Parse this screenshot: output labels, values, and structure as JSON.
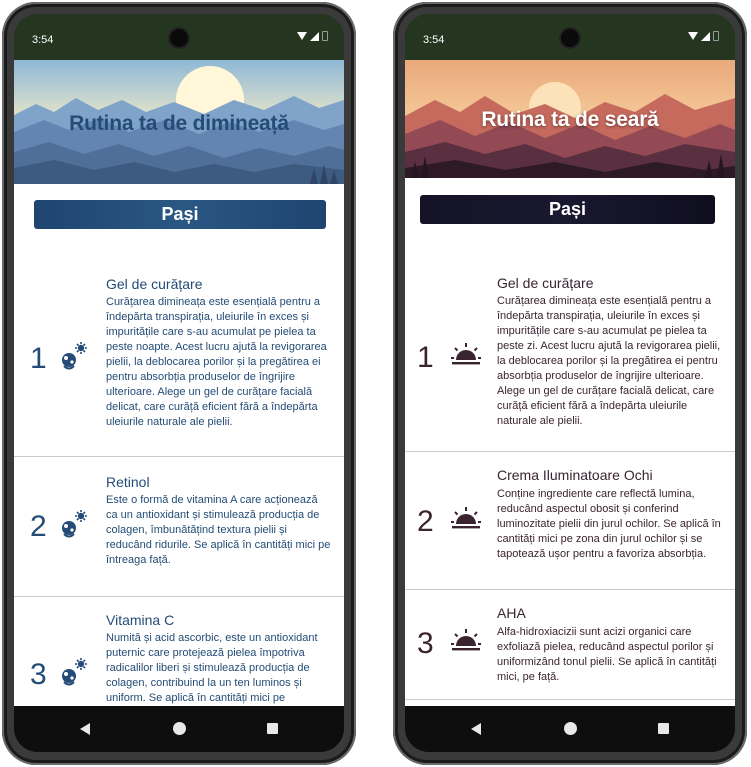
{
  "left": {
    "status_time": "3:54",
    "banner_title": "Rutina ta de dimineață",
    "steps_header": "Pași",
    "steps": [
      {
        "number": "1",
        "title": "Gel de curățare",
        "description": "Curățarea dimineața este esențială pentru a îndepărta transpirația, uleiurile în exces și impuritățile care s-au acumulat pe pielea ta peste noapte. Acest lucru ajută la revigorarea pielii, la deblocarea porilor și la pregătirea ei pentru absorbția produselor de îngrijire ulterioare. Alege un gel de curățare facială delicat, care curăță eficient fără a îndepărta uleiurile naturale ale pielii."
      },
      {
        "number": "2",
        "title": "Retinol",
        "description": "Este o formă de vitamina A care acționează ca un antioxidant și stimulează producția de colagen, îmbunătățind textura pielii și reducând ridurile. Se aplică în cantități mici pe întreaga față."
      },
      {
        "number": "3",
        "title": "Vitamina C",
        "description": "Numită și acid ascorbic, este un antioxidant puternic care protejează pielea împotriva radicalilor liberi și stimulează producția de colagen, contribuind la un ten luminos și uniform. Se aplică în cantități mici pe"
      }
    ],
    "step_icon": "baby-sun-icon",
    "accent_color": "#244c76"
  },
  "right": {
    "status_time": "3:54",
    "banner_title": "Rutina ta de seară",
    "steps_header": "Pași",
    "steps": [
      {
        "number": "1",
        "title": "Gel de curățare",
        "description": "Curățarea dimineața este esențială pentru a îndepărta transpirația, uleiurile în exces și impuritățile care s-au acumulat pe pielea ta peste zi. Acest lucru ajută la revigorarea pielii, la deblocarea porilor și la pregătirea ei pentru absorbția produselor de îngrijire ulterioare. Alege un gel de curățare facială delicat, care curăță eficient fără a îndepărta uleiurile naturale ale pielii."
      },
      {
        "number": "2",
        "title": "Crema Iluminatoare Ochi",
        "description": "Conține ingrediente care reflectă lumina, reducând aspectul obosit și conferind luminozitate pielii din jurul ochilor. Se aplică în cantități mici pe zona din jurul ochilor și se tapotează ușor pentru a favoriza absorbția."
      },
      {
        "number": "3",
        "title": "AHA",
        "description": "Alfa-hidroxiacizii sunt acizi organici care exfoliază pielea, reducând aspectul porilor și uniformizând tonul pielii. Se aplică în cantități mici, pe față."
      }
    ],
    "step_icon": "sunset-icon",
    "accent_color": "#3a2430"
  }
}
